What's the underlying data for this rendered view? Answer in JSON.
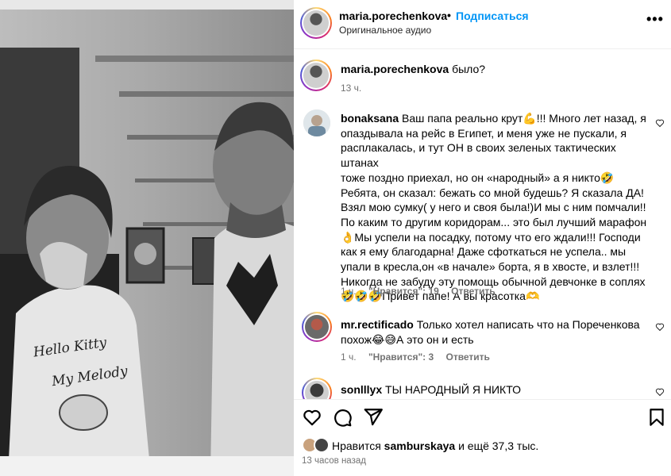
{
  "media": {
    "shirt_left_line1": "Hello Kitty",
    "shirt_left_line2": "My Melody"
  },
  "header": {
    "username": "maria.porechenkova",
    "dot": "•",
    "follow_label": "Подписаться",
    "audio_label": "Оригинальное аудио",
    "more_label": "•••"
  },
  "caption": {
    "username": "maria.porechenkova",
    "text": "было?",
    "time": "13 ч."
  },
  "comments": [
    {
      "username": "bonaksana",
      "lines": [
        "Ваш папа реально крут💪!!! Много лет назад, я",
        "опаздывала на рейс в Египет, и меня уже не пускали, я",
        "расплакалась, и тут ОН в своих зеленых тактических штанах",
        "тоже поздно приехал, но он «народный» а я никто🤣",
        "Ребята, он сказал: бежать со мной будешь? Я сказала ДА!",
        "Взял мою сумку( у него и своя была!)И мы с ним помчали!!",
        "По каким то другим коридорам... это был лучший марафон",
        "👌Мы успели на посадку, потому что его ждали!!! Господи",
        "как я ему благодарна! Даже сфоткаться не успела.. мы",
        "упали в кресла,он «в начале» борта, я в хвосте, и взлет!!!",
        "Никогда не забуду эту помощь обычной девчонке в соплях",
        "🤣🤣🤣Привет папе! А вы красотка🫶"
      ],
      "time": "1 ч.",
      "likes": "\"Нравится\": 19",
      "reply": "Ответить"
    },
    {
      "username": "mr.rectificado",
      "lines": [
        "Только хотел написать что на Пореченкова",
        "похож😂😅А это он и есть"
      ],
      "time": "1 ч.",
      "likes": "\"Нравится\": 3",
      "reply": "Ответить"
    },
    {
      "username": "sonlllyx",
      "lines": [
        "ТЫ НАРОДНЫЙ Я НИКТО"
      ],
      "time": "",
      "likes": "",
      "reply": ""
    }
  ],
  "likes": {
    "prefix": "Нравится",
    "user": "samburskaya",
    "suffix": "и ещё 37,3 тыс."
  },
  "post_time": "13 часов назад",
  "icons": [
    "heart-icon",
    "comment-icon",
    "share-icon",
    "bookmark-icon",
    "more-icon"
  ]
}
